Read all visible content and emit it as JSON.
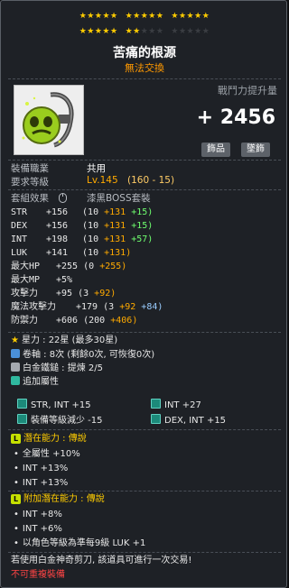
{
  "stars": {
    "row1": [
      "★★★★★",
      "★★★★★",
      "★★★★★"
    ],
    "row2_on": [
      "★★★★★",
      "★★"
    ],
    "row2_off": [
      "★★★",
      "★★★★★"
    ]
  },
  "item": {
    "name": "苦痛的根源",
    "trade": "無法交換",
    "power_label": "戰鬥力提升量",
    "power_value": "+ 2456",
    "tags": [
      "飾品",
      "墜飾"
    ]
  },
  "requirements": {
    "job_label": "裝備職業",
    "job_value": "共用",
    "level_label": "要求等級",
    "level_value": "Lv.145",
    "level_detail": "(160 - 15)"
  },
  "set_effect": {
    "label": "套組效果",
    "value": "漆黑BOSS套裝"
  },
  "stats": [
    {
      "name": "STR",
      "total": "+156",
      "detail": "(10",
      "a": "+131",
      "b": "+15)",
      "b_color": "green"
    },
    {
      "name": "DEX",
      "total": "+156",
      "detail": "(10",
      "a": "+131",
      "b": "+15)",
      "b_color": "green"
    },
    {
      "name": "INT",
      "total": "+198",
      "detail": "(10",
      "a": "+131",
      "b": "+57)",
      "b_color": "green"
    },
    {
      "name": "LUK",
      "total": "+141",
      "detail": "(10",
      "a": "+131)",
      "b": "",
      "b_color": "green"
    },
    {
      "name": "最大HP",
      "total": "+255",
      "detail": "(0",
      "a": "+255)",
      "b": "",
      "b_color": "green"
    },
    {
      "name": "最大MP",
      "total": "+5%",
      "detail": "",
      "a": "",
      "b": "",
      "b_color": "green"
    },
    {
      "name": "攻擊力",
      "total": "+95",
      "detail": "(3",
      "a": "+92)",
      "b": "",
      "b_color": "green"
    },
    {
      "name": "魔法攻擊力",
      "total": "+179",
      "detail": "(3",
      "a": "+92",
      "b": "+84)",
      "b_color": "blue"
    },
    {
      "name": "防禦力",
      "total": "+606",
      "detail": "(200",
      "a": "+406)",
      "b": "",
      "b_color": "green"
    }
  ],
  "upgrades": {
    "star": "星力 : 22星 (最多30星)",
    "scroll": "卷軸 : 8次 (剩餘0次, 可恢復0次)",
    "hammer": "白金鐵鎚 : 提煉 2/5",
    "addl_header": "追加屬性"
  },
  "addl_stats": [
    [
      "STR, INT  +15",
      "INT  +27"
    ],
    [
      "裝備等級減少 -15",
      "DEX, INT  +15"
    ]
  ],
  "potential": {
    "header": "潛在能力 : 傳說",
    "badge": "L",
    "lines": [
      "全屬性 +10%",
      "INT +13%",
      "INT +13%"
    ]
  },
  "bonus_potential": {
    "header": "附加潛在能力 : 傳說",
    "badge": "L",
    "lines": [
      "INT +8%",
      "INT +6%",
      "以角色等級為準每9級 LUK +1"
    ]
  },
  "footer": {
    "scissors_note": "若使用白金神奇剪刀, 該道具可進行一次交易!",
    "no_reset": "不可重複裝備"
  }
}
